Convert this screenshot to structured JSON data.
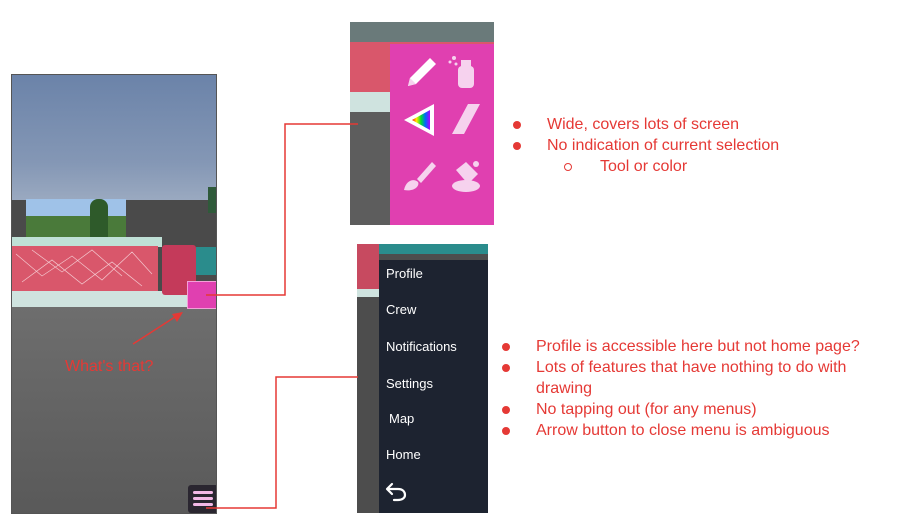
{
  "left_screen": {
    "annotation": "What's that?"
  },
  "tool_palette": {
    "tools": [
      "pencil-icon",
      "spray-can-icon",
      "color-triangle-icon",
      "eraser-icon",
      "brush-icon",
      "paint-bucket-icon"
    ]
  },
  "nav_menu": {
    "items": [
      {
        "label": "Profile"
      },
      {
        "label": "Crew"
      },
      {
        "label": "Notifications"
      },
      {
        "label": "Settings"
      },
      {
        "label": "Map"
      },
      {
        "label": "Home"
      }
    ],
    "back_icon": "back-arrow-icon"
  },
  "notes_palette": {
    "bullets": [
      "Wide, covers lots of screen",
      "No indication of current selection"
    ],
    "sub_bullets": [
      "Tool or color"
    ]
  },
  "notes_menu": {
    "bullets": [
      "Profile is accessible here but not home page?",
      "Lots of features that have nothing to do with",
      "No tapping out (for any menus)",
      "Arrow button to close menu is ambiguous"
    ],
    "continuation": "drawing"
  },
  "colors": {
    "annotation_red": "#e53935",
    "palette_pink": "#e040b0",
    "menu_bg": "#1d2330"
  }
}
